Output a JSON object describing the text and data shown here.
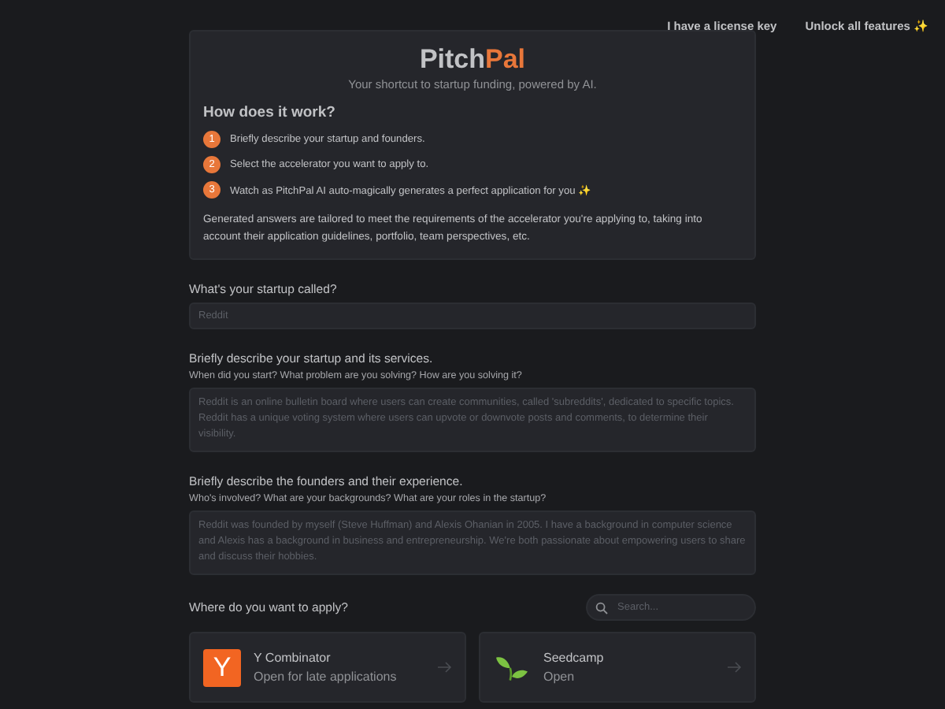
{
  "header_links": [
    "I have a license key",
    "Unlock all features ✨"
  ],
  "intro": {
    "title_main": "Pitch",
    "title_accent": "Pal",
    "tagline": "Your shortcut to startup funding, powered by AI.",
    "heading": "How does it work?",
    "steps": [
      {
        "number": "1",
        "text": "Briefly describe your startup and founders."
      },
      {
        "number": "2",
        "text": "Select the accelerator you want to apply to."
      },
      {
        "number": "3",
        "text": "Watch as PitchPal AI auto-magically generates a perfect application for you ✨"
      }
    ],
    "note": "Generated answers are tailored to meet the requirements of the accelerator you're applying to, taking into account their application guidelines, portfolio, team perspectives, etc."
  },
  "fields": [
    {
      "kind": "input",
      "label": "What's your startup called?",
      "placeholder": "Reddit"
    },
    {
      "kind": "textarea",
      "label": "Briefly describe your startup and its services.",
      "hint": "When did you start? What problem are you solving? How are you solving it?",
      "placeholder": "Reddit is an online bulletin board where users can create communities, called 'subreddits', dedicated to specific topics. Reddit has a unique voting system where users can upvote or downvote posts and comments, to determine their visibility."
    },
    {
      "kind": "textarea",
      "label": "Briefly describe the founders and their experience.",
      "hint": "Who's involved? What are your backgrounds? What are your roles in the startup?",
      "placeholder": "Reddit was founded by myself (Steve Huffman) and Alexis Ohanian in 2005. I have a background in computer science and Alexis has a background in business and entrepreneurship. We're both passionate about empowering users to share and discuss their hobbies."
    }
  ],
  "apply": {
    "heading": "Where do you want to apply?",
    "search": {
      "placeholder": "Search..."
    },
    "accelerators": [
      {
        "kind": "letter",
        "logo_text": "Y",
        "name": "Y Combinator",
        "status": "Open for late applications"
      },
      {
        "kind": "sprout",
        "name": "Seedcamp",
        "status": "Open"
      }
    ]
  }
}
